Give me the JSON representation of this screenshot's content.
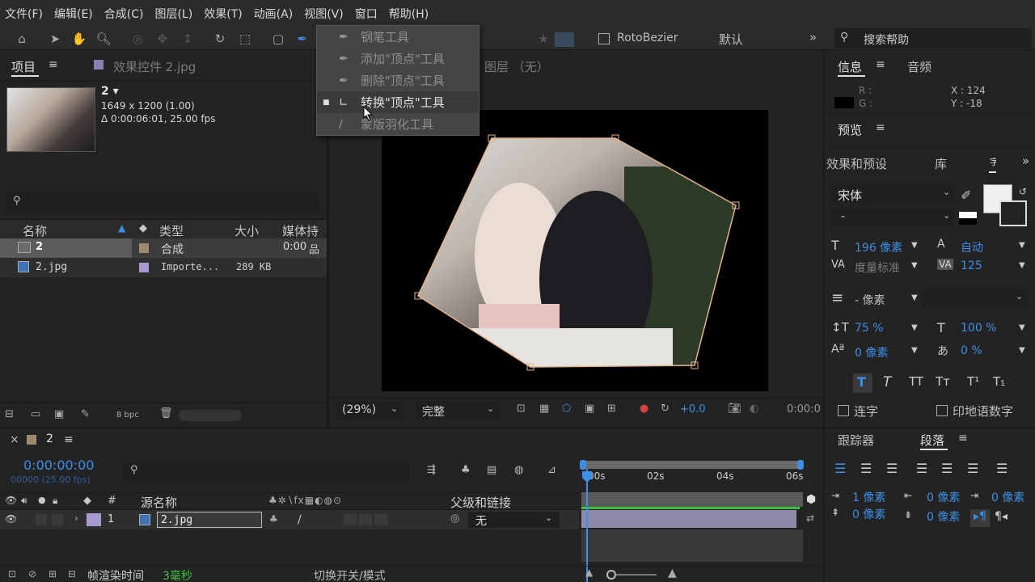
{
  "menu": [
    "文件(F)",
    "编辑(E)",
    "合成(C)",
    "图层(L)",
    "效果(T)",
    "动画(A)",
    "视图(V)",
    "窗口",
    "帮助(H)"
  ],
  "toolbar": {
    "rotobezier_label": "RotoBezier",
    "workspace_label": "默认",
    "search_placeholder": "搜索帮助"
  },
  "pen_menu": {
    "items": [
      {
        "label": "钢笔工具",
        "icon": "pen-icon"
      },
      {
        "label": "添加\"顶点\"工具",
        "icon": "add-vertex-icon"
      },
      {
        "label": "删除\"顶点\"工具",
        "icon": "delete-vertex-icon"
      },
      {
        "label": "转换\"顶点\"工具",
        "icon": "convert-vertex-icon",
        "selected": true
      },
      {
        "label": "蒙版羽化工具",
        "icon": "mask-feather-icon"
      }
    ]
  },
  "project": {
    "tab_label": "项目",
    "effects_tab": "效果控件 2.jpg",
    "item_name": "2 ▾",
    "item_dims": "1649 x 1200 (1.00)",
    "item_duration": "Δ 0:00:06:01, 25.00 fps",
    "search_icon": "⚲",
    "columns": {
      "name": "名称",
      "type": "类型",
      "size": "大小",
      "media": "媒体持"
    },
    "rows": [
      {
        "name": "2",
        "type": "合成",
        "size": "",
        "media": "0:00",
        "color": "#9c8b6e"
      },
      {
        "name": "2.jpg",
        "type": "Importe...",
        "size": "289 KB",
        "media": "",
        "color": "#a79ad0"
      }
    ],
    "bpc": "8 bpc"
  },
  "viewer": {
    "layer_tab": "图层 （无）",
    "zoom": "(29%)",
    "quality": "完整",
    "exposure": "+0.0",
    "timecode": "0:00:0"
  },
  "info": {
    "tab_info": "信息",
    "tab_audio": "音频",
    "r_label": "R :",
    "g_label": "G :",
    "x_label": "X : 124",
    "y_label": "Y : -18",
    "preview_tab": "预览",
    "effects_presets_tab": "效果和预设",
    "library_tab": "库",
    "overflow_tab": "字"
  },
  "character": {
    "font": "宋体",
    "style": "-",
    "size": "196 像素",
    "leading": "自动",
    "kerning": "度量标准",
    "tracking": "125",
    "stroke": "- 像素",
    "vscale": "75 %",
    "hscale": "100 %",
    "baseline": "0 像素",
    "tsume": "0 %",
    "ligature_label": "连字",
    "hindi_label": "印地语数字"
  },
  "paragraph": {
    "tracker_tab": "跟踪器",
    "paragraph_tab": "段落",
    "indent_left": "1 像素",
    "indent_right": "0 像素",
    "first_indent": "0 像素",
    "space_before": "0 像素",
    "space_after": "0 像素"
  },
  "timeline": {
    "comp_tab": "2",
    "timecode": "0:00:00:00",
    "frame_sub": "00000 (25.00 fps)",
    "columns": {
      "num": "#",
      "source": "源名称",
      "parent": "父级和链接"
    },
    "layer": {
      "num": "1",
      "name": "2.jpg",
      "parent": "无"
    },
    "ruler": [
      "00s",
      "02s",
      "04s",
      "06s"
    ],
    "render_label": "帧渲染时间",
    "render_value": "3毫秒",
    "toggle_label": "切换开关/模式"
  },
  "colors": {
    "accent_blue": "#3d8ee6",
    "layer_bar": "#8f8aa8",
    "green_bar": "#3fbf3f",
    "mask_handle": "#e6b38a"
  }
}
